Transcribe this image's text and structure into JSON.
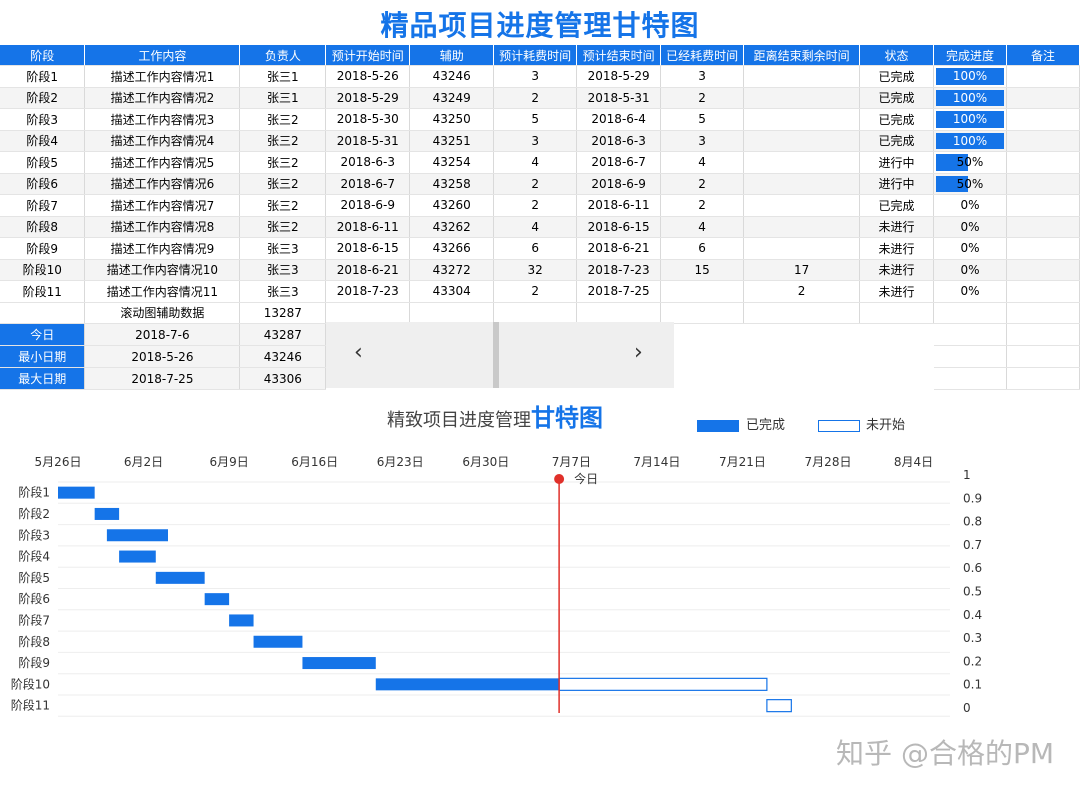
{
  "title": "精品项目进度管理甘特图",
  "headers": [
    "阶段",
    "工作内容",
    "负责人",
    "预计开始时间",
    "辅助",
    "预计耗费时间",
    "预计结束时间",
    "已经耗费时间",
    "距离结束剩余时间",
    "状态",
    "完成进度",
    "备注"
  ],
  "rows": [
    {
      "stage": "阶段1",
      "work": "描述工作内容情况1",
      "owner": "张三1",
      "start": "2018-5-26",
      "aux": "43246",
      "plan": "3",
      "end": "2018-5-29",
      "spent": "3",
      "remain": "",
      "status": "已完成",
      "pct": 100,
      "pct_label": "100%"
    },
    {
      "stage": "阶段2",
      "work": "描述工作内容情况2",
      "owner": "张三1",
      "start": "2018-5-29",
      "aux": "43249",
      "plan": "2",
      "end": "2018-5-31",
      "spent": "2",
      "remain": "",
      "status": "已完成",
      "pct": 100,
      "pct_label": "100%"
    },
    {
      "stage": "阶段3",
      "work": "描述工作内容情况3",
      "owner": "张三2",
      "start": "2018-5-30",
      "aux": "43250",
      "plan": "5",
      "end": "2018-6-4",
      "spent": "5",
      "remain": "",
      "status": "已完成",
      "pct": 100,
      "pct_label": "100%"
    },
    {
      "stage": "阶段4",
      "work": "描述工作内容情况4",
      "owner": "张三2",
      "start": "2018-5-31",
      "aux": "43251",
      "plan": "3",
      "end": "2018-6-3",
      "spent": "3",
      "remain": "",
      "status": "已完成",
      "pct": 100,
      "pct_label": "100%"
    },
    {
      "stage": "阶段5",
      "work": "描述工作内容情况5",
      "owner": "张三2",
      "start": "2018-6-3",
      "aux": "43254",
      "plan": "4",
      "end": "2018-6-7",
      "spent": "4",
      "remain": "",
      "status": "进行中",
      "pct": 50,
      "pct_label": "50%"
    },
    {
      "stage": "阶段6",
      "work": "描述工作内容情况6",
      "owner": "张三2",
      "start": "2018-6-7",
      "aux": "43258",
      "plan": "2",
      "end": "2018-6-9",
      "spent": "2",
      "remain": "",
      "status": "进行中",
      "pct": 50,
      "pct_label": "50%"
    },
    {
      "stage": "阶段7",
      "work": "描述工作内容情况7",
      "owner": "张三2",
      "start": "2018-6-9",
      "aux": "43260",
      "plan": "2",
      "end": "2018-6-11",
      "spent": "2",
      "remain": "",
      "status": "已完成",
      "pct": 0,
      "pct_label": "0%"
    },
    {
      "stage": "阶段8",
      "work": "描述工作内容情况8",
      "owner": "张三2",
      "start": "2018-6-11",
      "aux": "43262",
      "plan": "4",
      "end": "2018-6-15",
      "spent": "4",
      "remain": "",
      "status": "未进行",
      "pct": 0,
      "pct_label": "0%"
    },
    {
      "stage": "阶段9",
      "work": "描述工作内容情况9",
      "owner": "张三3",
      "start": "2018-6-15",
      "aux": "43266",
      "plan": "6",
      "end": "2018-6-21",
      "spent": "6",
      "remain": "",
      "status": "未进行",
      "pct": 0,
      "pct_label": "0%"
    },
    {
      "stage": "阶段10",
      "work": "描述工作内容情况10",
      "owner": "张三3",
      "start": "2018-6-21",
      "aux": "43272",
      "plan": "32",
      "end": "2018-7-23",
      "spent": "15",
      "remain": "17",
      "status": "未进行",
      "pct": 0,
      "pct_label": "0%"
    },
    {
      "stage": "阶段11",
      "work": "描述工作内容情况11",
      "owner": "张三3",
      "start": "2018-7-23",
      "aux": "43304",
      "plan": "2",
      "end": "2018-7-25",
      "spent": "",
      "remain": "2",
      "status": "未进行",
      "pct": 0,
      "pct_label": "0%"
    }
  ],
  "helper_row": {
    "label": "滚动图辅助数据",
    "value": "13287"
  },
  "info": [
    {
      "label": "今日",
      "date": "2018-7-6",
      "value": "43287"
    },
    {
      "label": "最小日期",
      "date": "2018-5-26",
      "value": "43246"
    },
    {
      "label": "最大日期",
      "date": "2018-7-25",
      "value": "43306"
    }
  ],
  "scroll": {
    "left": "‹",
    "right": "›"
  },
  "chart": {
    "title_pre": "精致项目进度管理",
    "title_bold": "甘特图",
    "legend_done": "已完成",
    "legend_todo": "未开始",
    "today_label": "今日"
  },
  "colors": {
    "accent": "#1574e8",
    "today_line": "#e0302a"
  },
  "watermark": "知乎 @合格的PM",
  "chart_data": {
    "type": "bar",
    "orientation": "horizontal-gantt",
    "x_ticks": [
      "5月26日",
      "6月2日",
      "6月9日",
      "6月16日",
      "6月23日",
      "6月30日",
      "7月7日",
      "7月14日",
      "7月21日",
      "7月28日",
      "8月4日"
    ],
    "x_tick_values": [
      43246,
      43253,
      43260,
      43267,
      43274,
      43281,
      43288,
      43295,
      43302,
      43309,
      43316
    ],
    "xlim": [
      43246,
      43318
    ],
    "today": 43287,
    "categories": [
      "阶段1",
      "阶段2",
      "阶段3",
      "阶段4",
      "阶段5",
      "阶段6",
      "阶段7",
      "阶段8",
      "阶段9",
      "阶段10",
      "阶段11"
    ],
    "start": [
      43246,
      43249,
      43250,
      43251,
      43254,
      43258,
      43260,
      43262,
      43266,
      43272,
      43304
    ],
    "done_duration": [
      3,
      2,
      5,
      3,
      4,
      2,
      2,
      4,
      6,
      15,
      0
    ],
    "todo_duration": [
      0,
      0,
      0,
      0,
      0,
      0,
      0,
      0,
      0,
      17,
      2
    ],
    "y2_ticks": [
      "1",
      "0.9",
      "0.8",
      "0.7",
      "0.6",
      "0.5",
      "0.4",
      "0.3",
      "0.2",
      "0.1",
      "0"
    ]
  }
}
